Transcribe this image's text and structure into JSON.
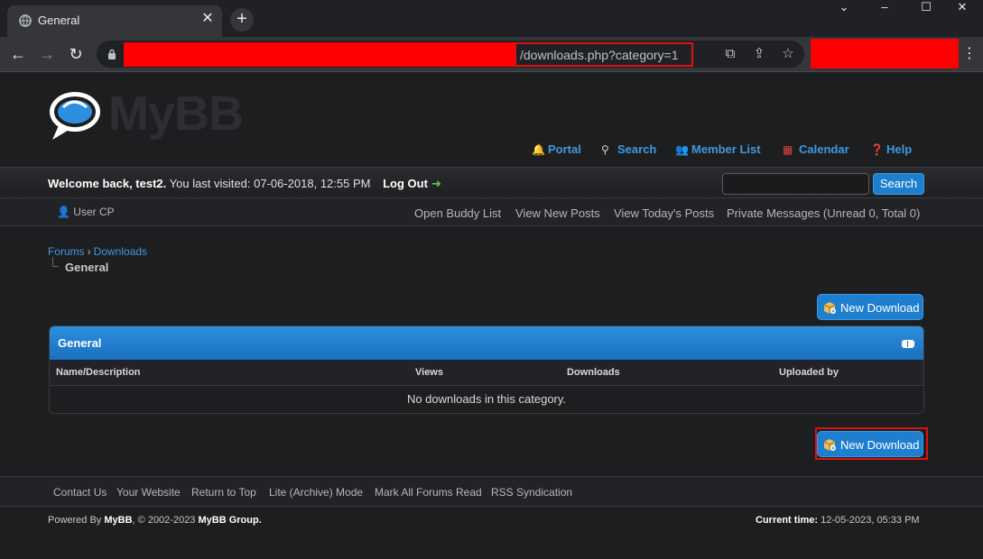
{
  "browser": {
    "tab_title": "General",
    "url_path": "/downloads.php?category=1"
  },
  "site": {
    "logo_text": "MyBB"
  },
  "top_menu": [
    {
      "label": "Portal",
      "icon": "bell-icon"
    },
    {
      "label": "Search",
      "icon": "magnifier-icon"
    },
    {
      "label": "Member List",
      "icon": "members-icon"
    },
    {
      "label": "Calendar",
      "icon": "calendar-icon"
    },
    {
      "label": "Help",
      "icon": "help-icon"
    }
  ],
  "welcome": {
    "prefix": "Welcome back, test2.",
    "visited": " You last visited: 07-06-2018, 12:55 PM",
    "logout": "Log Out",
    "search_button": "Search"
  },
  "user_bar": {
    "usercp": "User CP",
    "links": [
      "Open Buddy List",
      "View New Posts",
      "View Today's Posts",
      "Private Messages (Unread 0, Total 0)"
    ]
  },
  "breadcrumb": {
    "items": [
      "Forums",
      "Downloads"
    ],
    "separator": "›",
    "current": "General"
  },
  "actions": {
    "new_download": "New Download"
  },
  "table": {
    "title": "General",
    "columns": [
      "Name/Description",
      "Views",
      "Downloads",
      "Uploaded by"
    ],
    "empty_message": "No downloads in this category."
  },
  "footer": {
    "links": [
      "Contact Us",
      "Your Website",
      "Return to Top",
      "Lite (Archive) Mode",
      "Mark All Forums Read",
      "RSS Syndication"
    ],
    "powered_by": "Powered By",
    "mybb": "MyBB",
    "copyright": ", © 2002-2023",
    "group": "MyBB Group.",
    "current_time_label": "Current time:",
    "current_time": "12-05-2023, 05:33 PM"
  },
  "colors": {
    "accent": "#1f7fcf",
    "link": "#3f99e0",
    "background": "#1d1e20",
    "highlight": "#e01010"
  }
}
